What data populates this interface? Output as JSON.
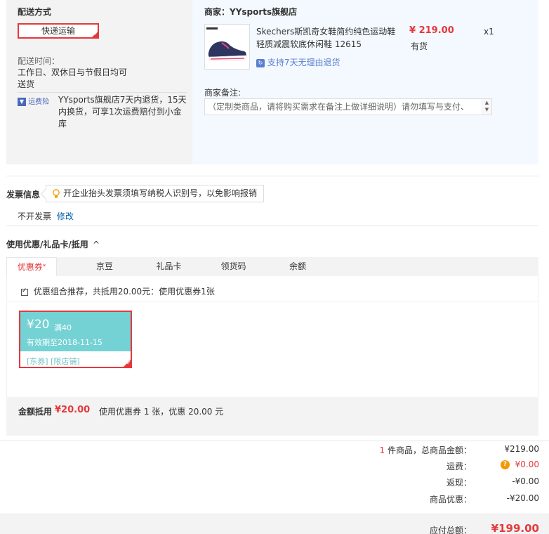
{
  "delivery": {
    "title": "配送方式",
    "method": "快递运输",
    "time_label": "配送时间：",
    "time_value_line1": "工作日、双休日与节假日均可",
    "time_value_line2": "送货",
    "insurance_badge": "运费险",
    "insurance_text_line1": "YYsports旗舰店7天内退货，15天",
    "insurance_text_line2": "内换货，可享1次运费赔付到小金",
    "insurance_text_line3": "库"
  },
  "merchant": {
    "label": "商家：YYsports旗舰店",
    "product_name_line1": "Skechers斯凯奇女鞋简约纯色运动鞋",
    "product_name_line2": "轻质减震软底休闲鞋 12615",
    "price": "¥ 219.00",
    "quantity": "x1",
    "stock": "有货",
    "return_policy": "支持7天无理由退货",
    "remark_label": "商家备注:",
    "remark_placeholder": "（定制类商品，请将购买需求在备注上做详细说明）请勿填写与支付、"
  },
  "invoice": {
    "title": "发票信息",
    "tip": "开企业抬头发票须填写纳税人识别号，以免影响报销",
    "status": "不开发票",
    "modify_link": "修改"
  },
  "discount": {
    "title": "使用优惠/礼品卡/抵用",
    "tabs": [
      "优惠券",
      "京豆",
      "礼品卡",
      "领货码",
      "余额"
    ],
    "recommend_text": "优惠组合推荐，共抵用20.00元：使用优惠券1张",
    "coupon": {
      "amount": "¥20",
      "condition": "满40",
      "validity": "有效期至2018-11-15",
      "tags": "[东券] [限店铺]"
    },
    "deduct_label": "金额抵用",
    "deduct_amount": "¥20.00",
    "deduct_desc": "使用优惠券 1 张，优惠 20.00 元"
  },
  "summary": {
    "item_count": "1",
    "item_count_suffix": " 件商品，总商品金额：",
    "total_goods": "¥219.00",
    "shipping_label": "运费：",
    "shipping_value": "¥0.00",
    "cashback_label": "返现：",
    "cashback_value": "-¥0.00",
    "goods_discount_label": "商品优惠：",
    "goods_discount_value": "-¥20.00",
    "payable_label": "应付总额：",
    "payable_value": "¥199.00"
  },
  "colors": {
    "accent_red": "#e4393c",
    "link_blue": "#005ea7",
    "coupon_teal": "#74d2d4",
    "warning_orange": "#f39800"
  }
}
